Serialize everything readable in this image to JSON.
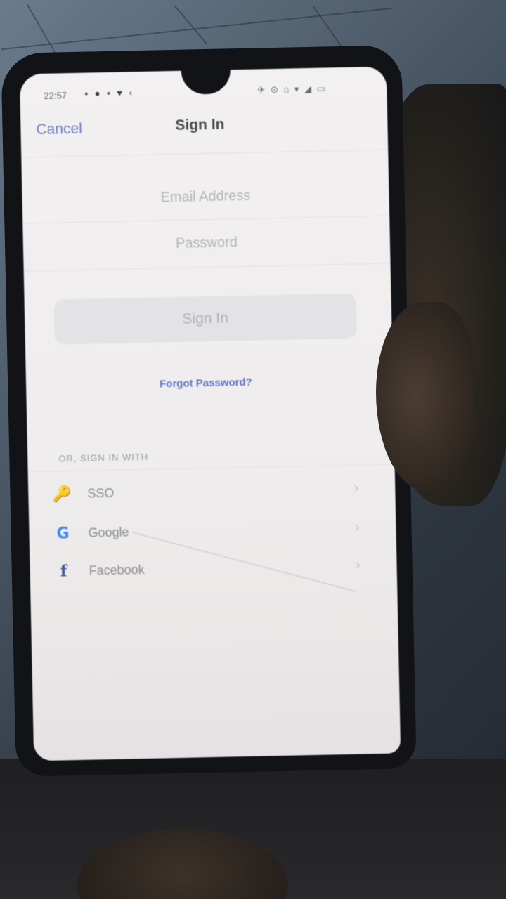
{
  "status_bar": {
    "time": "22:57",
    "left_icons": "▪ ● ▪ ♥ ‹",
    "right_icons": "✈ ⊙ ⌂ ▾ ◢ ▭"
  },
  "header": {
    "cancel_label": "Cancel",
    "title": "Sign In"
  },
  "form": {
    "email_placeholder": "Email Address",
    "password_placeholder": "Password",
    "signin_label": "Sign In",
    "forgot_label": "Forgot Password?"
  },
  "alt_signin": {
    "heading": "OR, SIGN IN WITH",
    "providers": [
      {
        "label": "SSO",
        "icon": "key-icon"
      },
      {
        "label": "Google",
        "icon": "google-icon"
      },
      {
        "label": "Facebook",
        "icon": "facebook-icon"
      }
    ]
  },
  "icons": {
    "key": "🔑",
    "google": "G",
    "facebook": "f",
    "chevron": "›"
  },
  "colors": {
    "link": "#5f75c8",
    "disabled_button": "#e3e2e4"
  }
}
